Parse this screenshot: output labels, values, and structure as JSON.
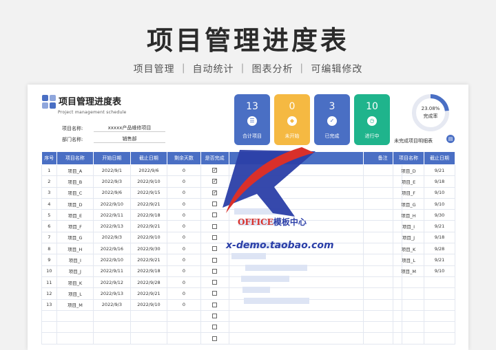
{
  "hero": {
    "title": "项目管理进度表",
    "subtitle": "项目管理 ｜ 自动统计 ｜ 图表分析 ｜ 可编辑修改"
  },
  "sheet": {
    "title": "项目管理进度表",
    "subtitle": "Project management schedule",
    "project_label": "项目名称:",
    "project_value": "xxxxx产品维修项目",
    "dept_label": "部门名称:",
    "dept_value": "销售部"
  },
  "cards": [
    {
      "value": "13",
      "label": "合计项目",
      "color": "#4a6fc4",
      "icon": "database-icon"
    },
    {
      "value": "0",
      "label": "未开始",
      "color": "#f5b942",
      "icon": "layers-icon"
    },
    {
      "value": "3",
      "label": "已完成",
      "color": "#4a6fc4",
      "icon": "check-icon"
    },
    {
      "value": "10",
      "label": "进行中",
      "color": "#1fb48c",
      "icon": "clock-icon"
    }
  ],
  "donut": {
    "percent_text": "23.08%",
    "label": "完成率",
    "fraction": 0.2308,
    "color": "#4a6fc4",
    "track_color": "#e6e9f2"
  },
  "main_table": {
    "headers": [
      "序号",
      "项目名称",
      "开始日期",
      "截止日期",
      "剩余天数",
      "是否完成",
      "",
      "备注"
    ],
    "rows": [
      [
        "1",
        "项目_A",
        "2022/9/1",
        "2022/9/6",
        "0",
        true
      ],
      [
        "2",
        "项目_B",
        "2022/9/3",
        "2022/9/10",
        "0",
        true
      ],
      [
        "3",
        "项目_C",
        "2022/9/6",
        "2022/9/15",
        "0",
        true
      ],
      [
        "4",
        "项目_D",
        "2022/9/10",
        "2022/9/21",
        "0",
        false
      ],
      [
        "5",
        "项目_E",
        "2022/9/11",
        "2022/9/18",
        "0",
        false
      ],
      [
        "6",
        "项目_F",
        "2022/9/13",
        "2022/9/21",
        "0",
        false
      ],
      [
        "7",
        "项目_G",
        "2022/9/3",
        "2022/9/10",
        "0",
        false
      ],
      [
        "8",
        "项目_H",
        "2022/9/16",
        "2022/9/30",
        "0",
        false
      ],
      [
        "9",
        "项目_I",
        "2022/9/10",
        "2022/9/21",
        "0",
        false
      ],
      [
        "10",
        "项目_J",
        "2022/9/11",
        "2022/9/18",
        "0",
        false
      ],
      [
        "11",
        "项目_K",
        "2022/9/12",
        "2022/9/28",
        "0",
        false
      ],
      [
        "12",
        "项目_L",
        "2022/9/13",
        "2022/9/21",
        "0",
        false
      ],
      [
        "13",
        "项目_M",
        "2022/9/3",
        "2022/9/10",
        "0",
        false
      ],
      [
        "",
        "",
        "",
        "",
        "",
        false
      ],
      [
        "",
        "",
        "",
        "",
        "",
        false
      ],
      [
        "",
        "",
        "",
        "",
        "",
        false
      ]
    ]
  },
  "unfinished": {
    "title": "未完成项目明细表",
    "headers": [
      "项目名称",
      "截止日期"
    ],
    "rows": [
      [
        "项目_D",
        "9/21"
      ],
      [
        "项目_E",
        "9/18"
      ],
      [
        "项目_F",
        "9/10"
      ],
      [
        "项目_G",
        "9/10"
      ],
      [
        "项目_H",
        "9/30"
      ],
      [
        "项目_I",
        "9/21"
      ],
      [
        "项目_J",
        "9/18"
      ],
      [
        "项目_K",
        "9/28"
      ],
      [
        "项目_L",
        "9/21"
      ],
      [
        "项目_M",
        "9/10"
      ],
      [
        "",
        ""
      ],
      [
        "",
        ""
      ],
      [
        "",
        ""
      ],
      [
        "",
        ""
      ],
      [
        "",
        ""
      ],
      [
        "",
        ""
      ]
    ]
  },
  "watermark": {
    "brand_a": "OFFICE",
    "brand_b": "模板中心",
    "url": "x-demo.taobao.com"
  },
  "colors": {
    "header_blue": "#4a6fc4",
    "gantt_fill": "#dde4f4"
  }
}
